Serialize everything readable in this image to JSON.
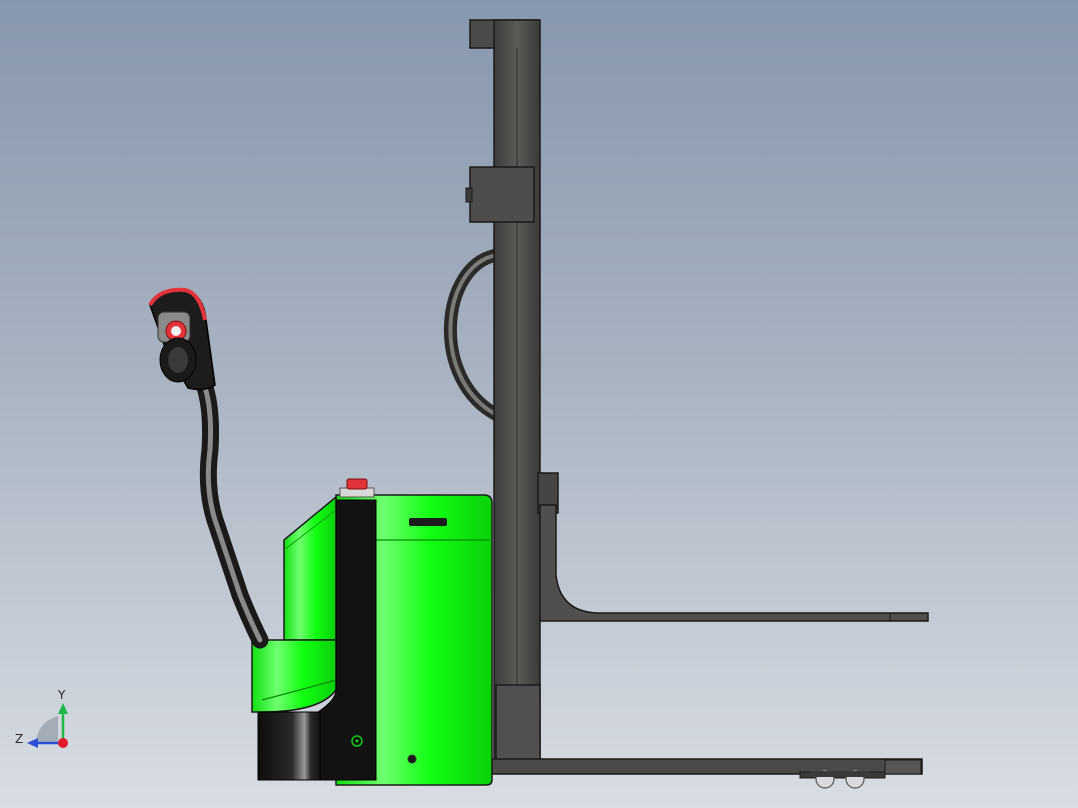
{
  "viewport": {
    "title": "",
    "background_top": "#8797ad",
    "background_bottom": "#d9dde3"
  },
  "model": {
    "name": "",
    "body_color": "#11ff11",
    "mast_color": "#4a4a48",
    "accent_color": "#e2333b",
    "dark_color": "#1c1c1c"
  },
  "triad": {
    "y_label": "Y",
    "z_label": "Z",
    "y_color": "#1fb84a",
    "z_color": "#2a4fd6",
    "x_color": "#e0182a"
  }
}
